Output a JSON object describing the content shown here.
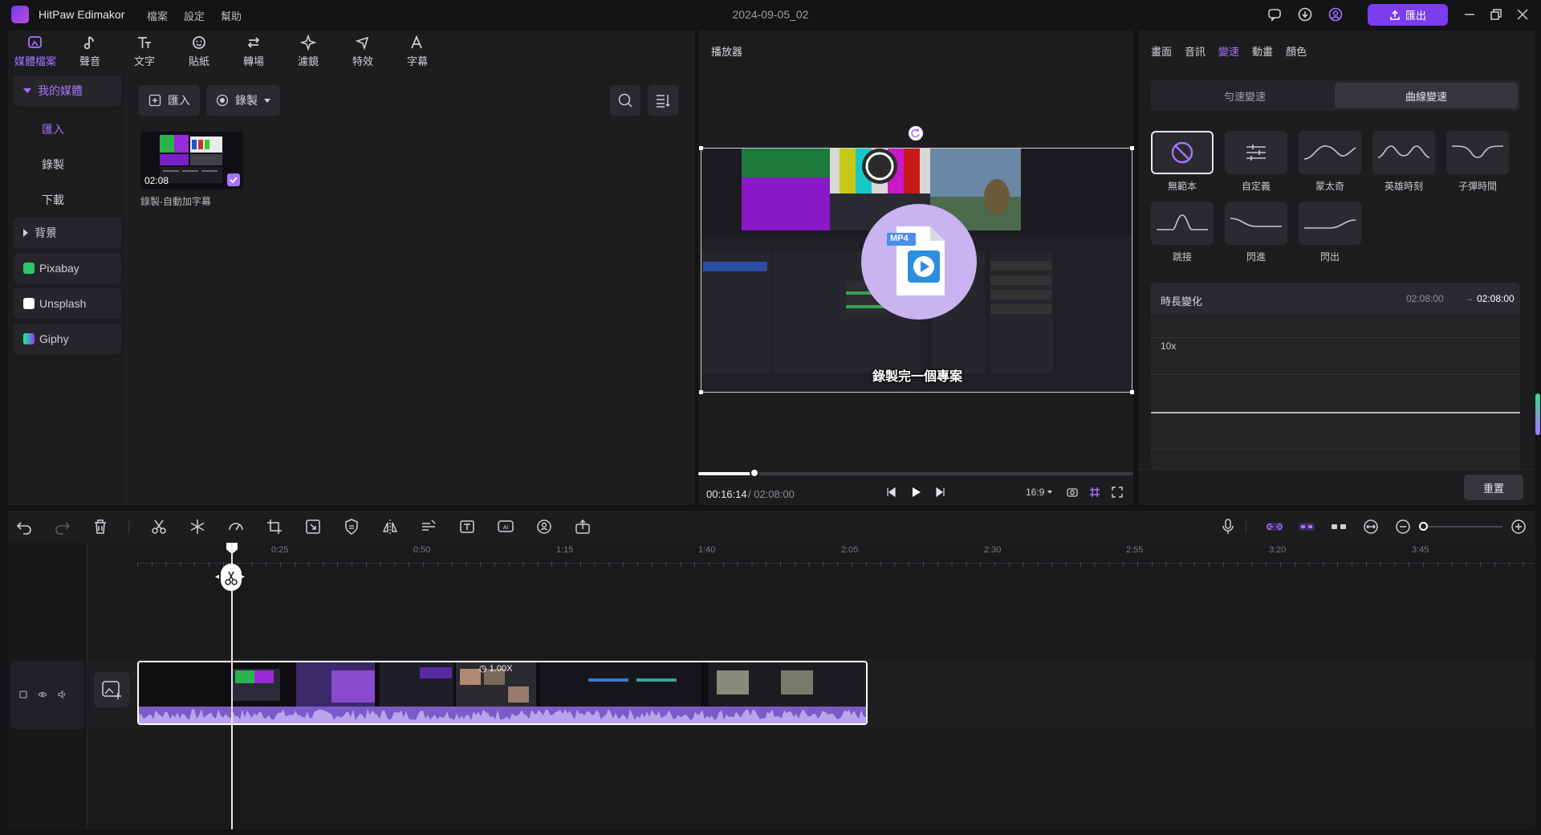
{
  "app": {
    "name": "HitPaw Edimakor",
    "doc_title": "2024-09-05_02",
    "export_label": "匯出"
  },
  "menu": [
    "檔案",
    "設定",
    "幫助"
  ],
  "tools": [
    {
      "label": "媒體檔案",
      "icon": "media-icon",
      "active": true
    },
    {
      "label": "聲音",
      "icon": "music-note-icon"
    },
    {
      "label": "文字",
      "icon": "text-icon"
    },
    {
      "label": "貼紙",
      "icon": "sticker-icon"
    },
    {
      "label": "轉場",
      "icon": "transition-icon"
    },
    {
      "label": "濾鏡",
      "icon": "filter-icon"
    },
    {
      "label": "特效",
      "icon": "effects-icon"
    },
    {
      "label": "字幕",
      "icon": "subtitle-icon"
    }
  ],
  "sidebar": {
    "my_media": "我的媒體",
    "sub_items": [
      "匯入",
      "錄製",
      "下載"
    ],
    "background": "背景",
    "sources": [
      "Pixabay",
      "Unsplash",
      "Giphy"
    ]
  },
  "media": {
    "import_label": "匯入",
    "record_label": "錄製",
    "item": {
      "duration": "02:08",
      "label": "錄製-自動加字幕"
    }
  },
  "player": {
    "title": "播放器",
    "subtitle": "錄製完一個專案",
    "current_time": "00:16:14",
    "total_time": "/ 02:08:00",
    "progress": 0.13,
    "aspect": "16:9",
    "overlay_badge": "MP4"
  },
  "right_panel": {
    "tabs": [
      "畫面",
      "音訊",
      "變速",
      "動畫",
      "顏色"
    ],
    "active_tab": "變速",
    "speed_modes": [
      "勻速變速",
      "曲線變速"
    ],
    "presets": [
      "無範本",
      "自定義",
      "蒙太奇",
      "英雄時刻",
      "子彈時間",
      "跳接",
      "閃進",
      "閃出"
    ],
    "duration_label": "時長變化",
    "duration_from": "02:08:00",
    "duration_to": "02:08:00",
    "graph_max": "10x",
    "reset_label": "重置"
  },
  "timeline": {
    "ruler": [
      "0:25",
      "0:50",
      "1:15",
      "1:40",
      "2:05",
      "2:30",
      "2:55",
      "3:20",
      "3:45"
    ],
    "clip_speed": "1.00X"
  },
  "colors": {
    "accent": "#a574ff",
    "export": "#7c3cf0",
    "bg": "#141416",
    "panel": "#1d1d20"
  }
}
